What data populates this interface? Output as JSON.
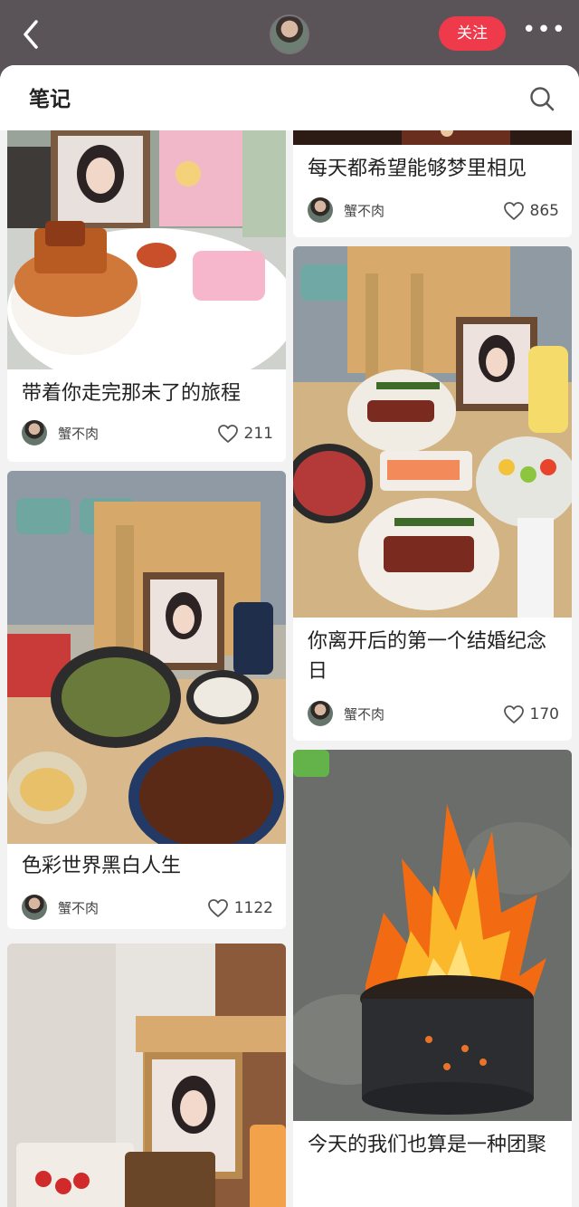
{
  "header": {
    "follow_label": "关注",
    "more_label": "•••"
  },
  "sheet": {
    "title": "笔记"
  },
  "colors": {
    "accent": "#ef3a4c",
    "topbar": "#5a5358",
    "sheet_bg": "#f2f2f2"
  },
  "notes": [
    {
      "title": "带着你走完那未了的旅程",
      "author": "蟹不肉",
      "likes": "211"
    },
    {
      "title": "色彩世界黑白人生",
      "author": "蟹不肉",
      "likes": "1122"
    },
    {
      "title": "",
      "author": "",
      "likes": ""
    },
    {
      "title": "每天都希望能够梦里相见",
      "author": "蟹不肉",
      "likes": "865"
    },
    {
      "title": "你离开后的第一个结婚纪念日",
      "author": "蟹不肉",
      "likes": "170"
    },
    {
      "title": "今天的我们也算是一种团聚",
      "author": "",
      "likes": ""
    }
  ],
  "icons": {
    "back": "chevron-left-icon",
    "search": "search-icon",
    "like": "heart-outline-icon"
  }
}
